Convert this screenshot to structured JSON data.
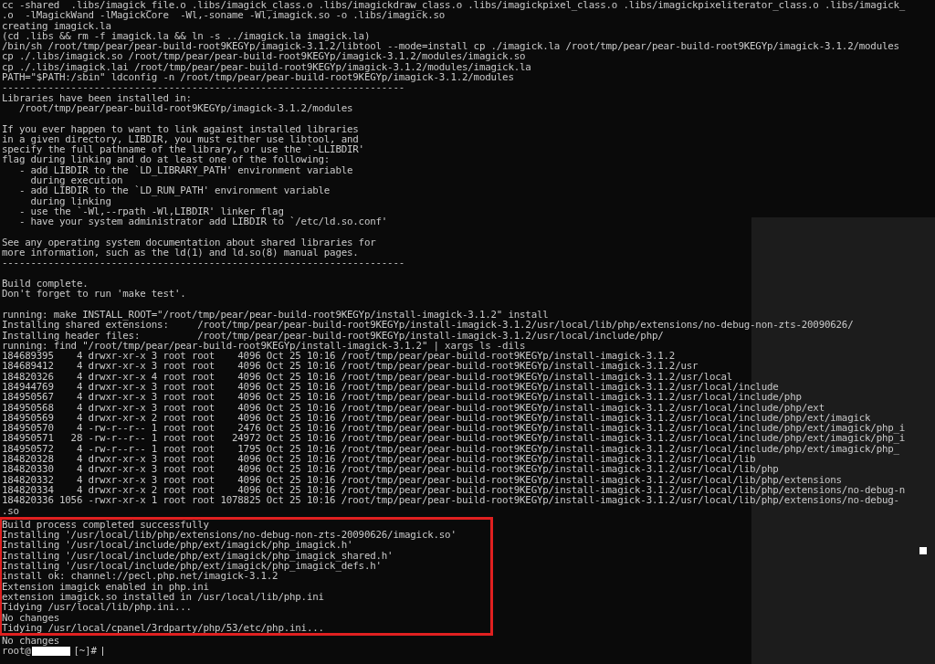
{
  "terminal": {
    "output_blocks": [
      [
        "cc -shared  .libs/imagick_file.o .libs/imagick_class.o .libs/imagickdraw_class.o .libs/imagickpixel_class.o .libs/imagickpixeliterator_class.o .libs/imagick_",
        ".o  -lMagickWand -lMagickCore  -Wl,-soname -Wl,imagick.so -o .libs/imagick.so",
        "creating imagick.la",
        "(cd .libs && rm -f imagick.la && ln -s ../imagick.la imagick.la)",
        "/bin/sh /root/tmp/pear/pear-build-root9KEGYp/imagick-3.1.2/libtool --mode=install cp ./imagick.la /root/tmp/pear/pear-build-root9KEGYp/imagick-3.1.2/modules",
        "cp ./.libs/imagick.so /root/tmp/pear/pear-build-root9KEGYp/imagick-3.1.2/modules/imagick.so",
        "cp ./.libs/imagick.lai /root/tmp/pear/pear-build-root9KEGYp/imagick-3.1.2/modules/imagick.la",
        "PATH=\"$PATH:/sbin\" ldconfig -n /root/tmp/pear/pear-build-root9KEGYp/imagick-3.1.2/modules",
        "----------------------------------------------------------------------",
        "Libraries have been installed in:",
        "   /root/tmp/pear/pear-build-root9KEGYp/imagick-3.1.2/modules"
      ],
      [
        "If you ever happen to want to link against installed libraries",
        "in a given directory, LIBDIR, you must either use libtool, and",
        "specify the full pathname of the library, or use the `-LLIBDIR'",
        "flag during linking and do at least one of the following:",
        "   - add LIBDIR to the `LD_LIBRARY_PATH' environment variable",
        "     during execution",
        "   - add LIBDIR to the `LD_RUN_PATH' environment variable",
        "     during linking",
        "   - use the `-Wl,--rpath -Wl,LIBDIR' linker flag",
        "   - have your system administrator add LIBDIR to `/etc/ld.so.conf'"
      ],
      [
        "See any operating system documentation about shared libraries for",
        "more information, such as the ld(1) and ld.so(8) manual pages.",
        "----------------------------------------------------------------------"
      ],
      [
        "Build complete.",
        "Don't forget to run 'make test'."
      ],
      [
        "running: make INSTALL_ROOT=\"/root/tmp/pear/pear-build-root9KEGYp/install-imagick-3.1.2\" install",
        "Installing shared extensions:     /root/tmp/pear/pear-build-root9KEGYp/install-imagick-3.1.2/usr/local/lib/php/extensions/no-debug-non-zts-20090626/",
        "Installing header files:          /root/tmp/pear/pear-build-root9KEGYp/install-imagick-3.1.2/usr/local/include/php/",
        "running: find \"/root/tmp/pear/pear-build-root9KEGYp/install-imagick-3.1.2\" | xargs ls -dils",
        "184689395    4 drwxr-xr-x 3 root root    4096 Oct 25 10:16 /root/tmp/pear/pear-build-root9KEGYp/install-imagick-3.1.2",
        "184689412    4 drwxr-xr-x 3 root root    4096 Oct 25 10:16 /root/tmp/pear/pear-build-root9KEGYp/install-imagick-3.1.2/usr",
        "184820326    4 drwxr-xr-x 4 root root    4096 Oct 25 10:16 /root/tmp/pear/pear-build-root9KEGYp/install-imagick-3.1.2/usr/local",
        "184944769    4 drwxr-xr-x 3 root root    4096 Oct 25 10:16 /root/tmp/pear/pear-build-root9KEGYp/install-imagick-3.1.2/usr/local/include",
        "184950567    4 drwxr-xr-x 3 root root    4096 Oct 25 10:16 /root/tmp/pear/pear-build-root9KEGYp/install-imagick-3.1.2/usr/local/include/php",
        "184950568    4 drwxr-xr-x 3 root root    4096 Oct 25 10:16 /root/tmp/pear/pear-build-root9KEGYp/install-imagick-3.1.2/usr/local/include/php/ext",
        "184950569    4 drwxr-xr-x 2 root root    4096 Oct 25 10:16 /root/tmp/pear/pear-build-root9KEGYp/install-imagick-3.1.2/usr/local/include/php/ext/imagick",
        "184950570    4 -rw-r--r-- 1 root root    2476 Oct 25 10:16 /root/tmp/pear/pear-build-root9KEGYp/install-imagick-3.1.2/usr/local/include/php/ext/imagick/php_i",
        "184950571   28 -rw-r--r-- 1 root root   24972 Oct 25 10:16 /root/tmp/pear/pear-build-root9KEGYp/install-imagick-3.1.2/usr/local/include/php/ext/imagick/php_i",
        "184950572    4 -rw-r--r-- 1 root root    1795 Oct 25 10:16 /root/tmp/pear/pear-build-root9KEGYp/install-imagick-3.1.2/usr/local/include/php/ext/imagick/php_",
        "184820328    4 drwxr-xr-x 3 root root    4096 Oct 25 10:16 /root/tmp/pear/pear-build-root9KEGYp/install-imagick-3.1.2/usr/local/lib",
        "184820330    4 drwxr-xr-x 3 root root    4096 Oct 25 10:16 /root/tmp/pear/pear-build-root9KEGYp/install-imagick-3.1.2/usr/local/lib/php",
        "184820332    4 drwxr-xr-x 3 root root    4096 Oct 25 10:16 /root/tmp/pear/pear-build-root9KEGYp/install-imagick-3.1.2/usr/local/lib/php/extensions",
        "184820334    4 drwxr-xr-x 2 root root    4096 Oct 25 10:16 /root/tmp/pear/pear-build-root9KEGYp/install-imagick-3.1.2/usr/local/lib/php/extensions/no-debug-n",
        "184820336 1056 -rwxr-xr-x 1 root root 1078825 Oct 25 10:16 /root/tmp/pear/pear-build-root9KEGYp/install-imagick-3.1.2/usr/local/lib/php/extensions/no-debug-",
        ".so"
      ]
    ],
    "highlighted_block": [
      "Build process completed successfully",
      "Installing '/usr/local/lib/php/extensions/no-debug-non-zts-20090626/imagick.so'",
      "Installing '/usr/local/include/php/ext/imagick/php_imagick.h'",
      "Installing '/usr/local/include/php/ext/imagick/php_imagick_shared.h'",
      "Installing '/usr/local/include/php/ext/imagick/php_imagick_defs.h'",
      "install ok: channel://pecl.php.net/imagick-3.1.2",
      "Extension imagick enabled in php.ini",
      "extension imagick.so installed in /usr/local/lib/php.ini",
      "Tidying /usr/local/lib/php.ini...",
      "No changes",
      "Tidying /usr/local/cpanel/3rdparty/php/53/etc/php.ini..."
    ],
    "trailing_lines": [
      "No changes"
    ],
    "prompt": {
      "user": "root@",
      "hostname_redacted": true,
      "path": "[~]#"
    }
  }
}
